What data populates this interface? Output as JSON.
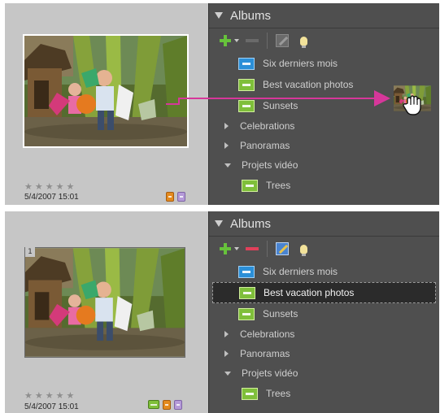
{
  "panels": [
    {
      "state": "dragging",
      "thumbnail": {
        "rating_stars": "★★★★★",
        "datetime": "5/4/2007 15:01",
        "tags": [
          "orange-tag-icon",
          "purple-tag-icon"
        ]
      },
      "albums": {
        "title": "Albums",
        "toolbar": {
          "add": "plus-icon",
          "remove": "minus-icon",
          "edit": "edit-icon",
          "info": "bulb-icon"
        },
        "items": [
          {
            "label": "Six derniers mois",
            "kind": "smart-album"
          },
          {
            "label": "Best vacation photos",
            "kind": "album"
          },
          {
            "label": "Sunsets",
            "kind": "album"
          },
          {
            "label": "Celebrations",
            "kind": "group"
          },
          {
            "label": "Panoramas",
            "kind": "group"
          },
          {
            "label": "Projets vidéo",
            "kind": "group-expanded"
          },
          {
            "label": "Trees",
            "kind": "album"
          }
        ]
      }
    },
    {
      "state": "dropped",
      "thumbnail": {
        "number_badge": "1",
        "rating_stars": "★★★★★",
        "datetime": "5/4/2007 15:01",
        "tags": [
          "album-tag-icon",
          "orange-tag-icon",
          "purple-tag-icon"
        ]
      },
      "albums": {
        "title": "Albums",
        "toolbar": {
          "add": "plus-icon",
          "remove": "minus-icon",
          "edit": "edit-icon",
          "info": "bulb-icon"
        },
        "items": [
          {
            "label": "Six derniers mois",
            "kind": "smart-album"
          },
          {
            "label": "Best vacation photos",
            "kind": "album",
            "selected": true
          },
          {
            "label": "Sunsets",
            "kind": "album"
          },
          {
            "label": "Celebrations",
            "kind": "group"
          },
          {
            "label": "Panoramas",
            "kind": "group"
          },
          {
            "label": "Projets vidéo",
            "kind": "group-expanded"
          },
          {
            "label": "Trees",
            "kind": "album"
          }
        ]
      }
    }
  ],
  "colors": {
    "panel_bg": "#4f4f4f",
    "thumb_bg": "#c6c6c6",
    "drag_arrow": "#d6379a",
    "selected_bg": "#2b2b2b",
    "smart_album_icon": "#2b8fd8",
    "album_icon": "#7fbf3a",
    "add_icon": "#67c23b",
    "remove_icon_active": "#e0405a"
  }
}
